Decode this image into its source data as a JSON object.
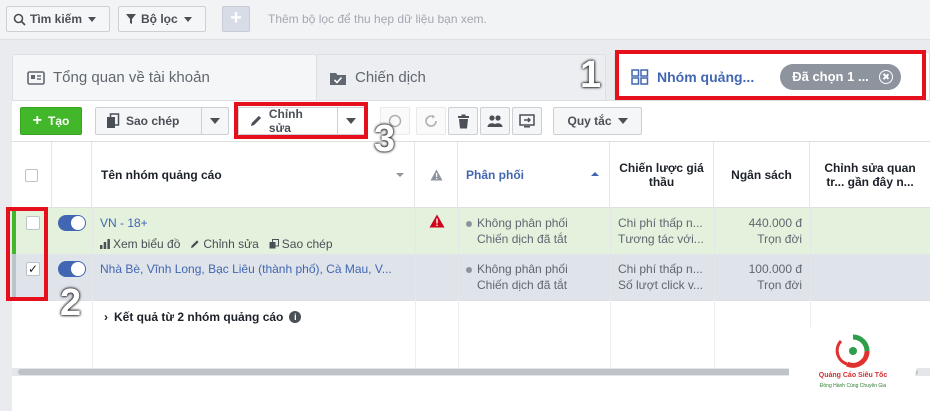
{
  "filter_bar": {
    "search_label": "Tìm kiếm",
    "filter_label": "Bộ lọc",
    "add_label": "+",
    "hint": "Thêm bộ lọc để thu hẹp dữ liệu bạn xem."
  },
  "tabs": {
    "account": "Tổng quan về tài khoản",
    "campaign": "Chiến dịch",
    "adset": "Nhóm quảng...",
    "selected_chip": "Đã chọn 1 ..."
  },
  "toolbar": {
    "create": "Tạo",
    "copy": "Sao chép",
    "edit": "Chỉnh sửa",
    "rules": "Quy tắc"
  },
  "table": {
    "headers": {
      "name": "Tên nhóm quảng cáo",
      "delivery": "Phân phối",
      "bid_strategy": "Chiến lược giá thầu",
      "budget": "Ngân sách",
      "recent_edit": "Chỉnh sửa quan tr... gần đây n..."
    },
    "rows": [
      {
        "name": "VN - 18+",
        "actions": [
          "Xem biểu đồ",
          "Chỉnh sửa",
          "Sao chép"
        ],
        "delivery": "Không phân phối",
        "delivery_sub": "Chiến dịch đã tắt",
        "bid": "Chi phí thấp n...",
        "bid_sub": "Tương tác với...",
        "budget": "440.000 đ",
        "budget_sub": "Trọn đời",
        "checked": false,
        "warning": true
      },
      {
        "name": "Nhà Bè, Vĩnh Long, Bạc Liêu (thành phố), Cà Mau, V...",
        "delivery": "Không phân phối",
        "delivery_sub": "Chiến dịch đã tắt",
        "bid": "Chi phí thấp n...",
        "bid_sub": "Số lượt click v...",
        "budget": "100.000 đ",
        "budget_sub": "Trọn đời",
        "checked": true,
        "warning": false
      }
    ],
    "summary": "Kết quả từ 2 nhóm quảng cáo"
  },
  "annotations": {
    "marker1": "1",
    "marker2": "2",
    "marker3": "3"
  },
  "logo": {
    "name": "Quảng Cáo Siêu Tốc",
    "tagline": "Đồng Hành Cùng Chuyên Gia"
  },
  "colors": {
    "accent": "#4267b2",
    "create_green": "#42b72a",
    "highlight_red": "#e5101b",
    "warning_red": "#d0021b"
  }
}
